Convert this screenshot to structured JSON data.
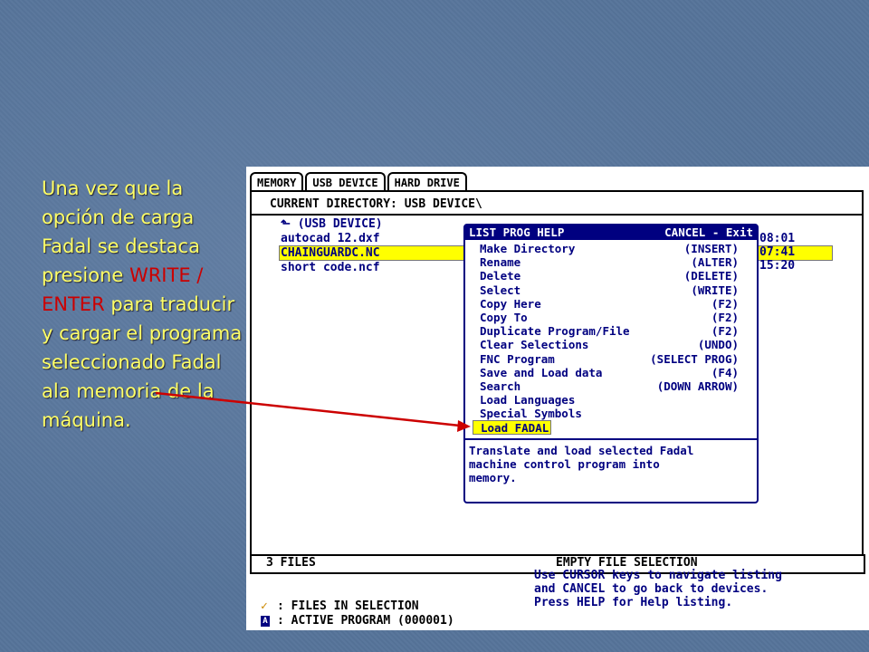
{
  "caption": {
    "part1": " Una vez que la opción de carga Fadal se destaca presione ",
    "key1": "WRITE /",
    "space": " ",
    "key2": "ENTER",
    "part2": " para traducir y cargar el programa seleccionado Fadal ala memoria de la máquina."
  },
  "tabs": [
    "MEMORY",
    "USB DEVICE",
    "HARD DRIVE"
  ],
  "current_directory": "CURRENT DIRECTORY: USB DEVICE\\",
  "files": [
    {
      "name": "(USB DEVICE)",
      "time": ""
    },
    {
      "name": "autocad 12.dxf",
      "time": "08:01"
    },
    {
      "name": "CHAINGUARDC.NC",
      "time": "07:41"
    },
    {
      "name": "short code.ncf",
      "time": "15:20"
    }
  ],
  "popup": {
    "title": "LIST PROG HELP",
    "cancel": "CANCEL - Exit",
    "items": [
      {
        "label": "Make Directory",
        "key": "(INSERT)"
      },
      {
        "label": "Rename",
        "key": "(ALTER)"
      },
      {
        "label": "Delete",
        "key": "(DELETE)"
      },
      {
        "label": "Select",
        "key": "(WRITE)"
      },
      {
        "label": "Copy Here",
        "key": "(F2)"
      },
      {
        "label": "Copy To",
        "key": "(F2)"
      },
      {
        "label": "Duplicate Program/File",
        "key": "(F2)"
      },
      {
        "label": "Clear Selections",
        "key": "(UNDO)"
      },
      {
        "label": "FNC Program",
        "key": "(SELECT PROG)"
      },
      {
        "label": "Save and Load data",
        "key": "(F4)"
      },
      {
        "label": "Search",
        "key": "(DOWN ARROW)"
      },
      {
        "label": "Load Languages",
        "key": ""
      },
      {
        "label": "Special Symbols",
        "key": ""
      },
      {
        "label": "Load FADAL",
        "key": ""
      }
    ],
    "help_lines": [
      "Translate and load selected Fadal",
      "machine control program into",
      "memory."
    ]
  },
  "status": {
    "files_count": "3 FILES",
    "selection": "EMPTY FILE SELECTION"
  },
  "nav_help": [
    "Use CURSOR keys to navigate listing",
    "and CANCEL to go back to devices.",
    "Press HELP for Help listing."
  ],
  "legend": {
    "files_in_selection": ": FILES IN SELECTION",
    "active_program": ": ACTIVE PROGRAM (000001)"
  },
  "colors": {
    "background": "#56749a",
    "caption_text": "#ffff66",
    "caption_highlight": "#cc0000",
    "screen_text": "#000080",
    "selection": "#ffff00",
    "pointer_line": "#cc0000"
  }
}
